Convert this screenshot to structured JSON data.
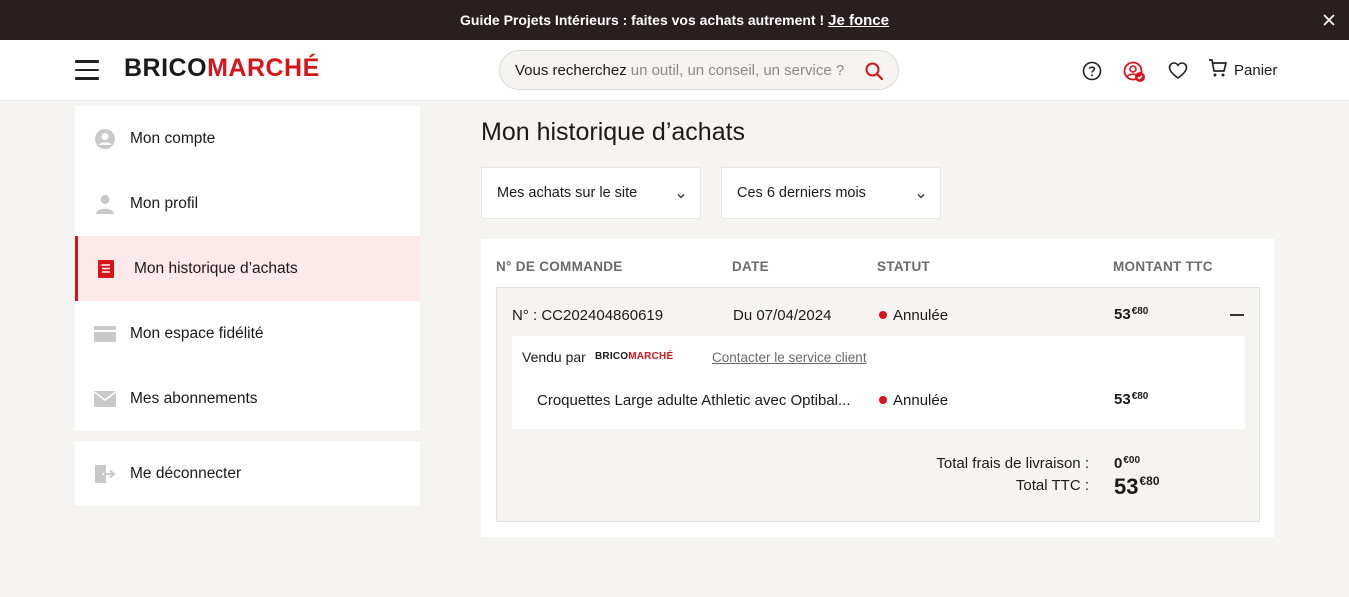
{
  "promo": {
    "text": "Guide Projets Intérieurs : faites vos achats autrement !",
    "link": "Je fonce"
  },
  "header": {
    "logo_part1": "BRICO",
    "logo_part2": "MARCHÉ",
    "search_strong": "Vous recherchez",
    "search_placeholder": "un outil, un conseil, un service ?",
    "cart_label": "Panier"
  },
  "sidebar": {
    "items": [
      {
        "label": "Mon compte",
        "icon": "account-circle-icon"
      },
      {
        "label": "Mon profil",
        "icon": "user-icon"
      },
      {
        "label": "Mon historique d’achats",
        "icon": "receipt-icon"
      },
      {
        "label": "Mon espace fidélité",
        "icon": "card-icon"
      },
      {
        "label": "Mes abonnements",
        "icon": "envelope-icon"
      }
    ],
    "logout": "Me déconnecter"
  },
  "main": {
    "title": "Mon historique d’achats",
    "filter_channel": "Mes achats sur le site",
    "filter_period": "Ces 6 derniers mois",
    "headers": {
      "order": "N° DE COMMANDE",
      "date": "DATE",
      "status": "STATUT",
      "amount": "MONTANT TTC"
    },
    "order": {
      "number": "N° : CC202404860619",
      "date": "Du 07/04/2024",
      "status": "Annulée",
      "amount_int": "53",
      "amount_dec": "€80",
      "sold_by": "Vendu par",
      "seller_part1": "BRICO",
      "seller_part2": "MARCHÉ",
      "contact": "Contacter le service client",
      "item_name": "Croquettes Large adulte Athletic avec Optibal...",
      "item_status": "Annulée",
      "item_amount_int": "53",
      "item_amount_dec": "€80",
      "delivery_label": "Total frais de livraison :",
      "delivery_int": "0",
      "delivery_dec": "€00",
      "total_label": "Total TTC :",
      "total_int": "53",
      "total_dec": "€80"
    }
  },
  "colors": {
    "brand_red": "#d7141a",
    "dark": "#2a1f1f",
    "active_bg": "#fde8ea"
  }
}
